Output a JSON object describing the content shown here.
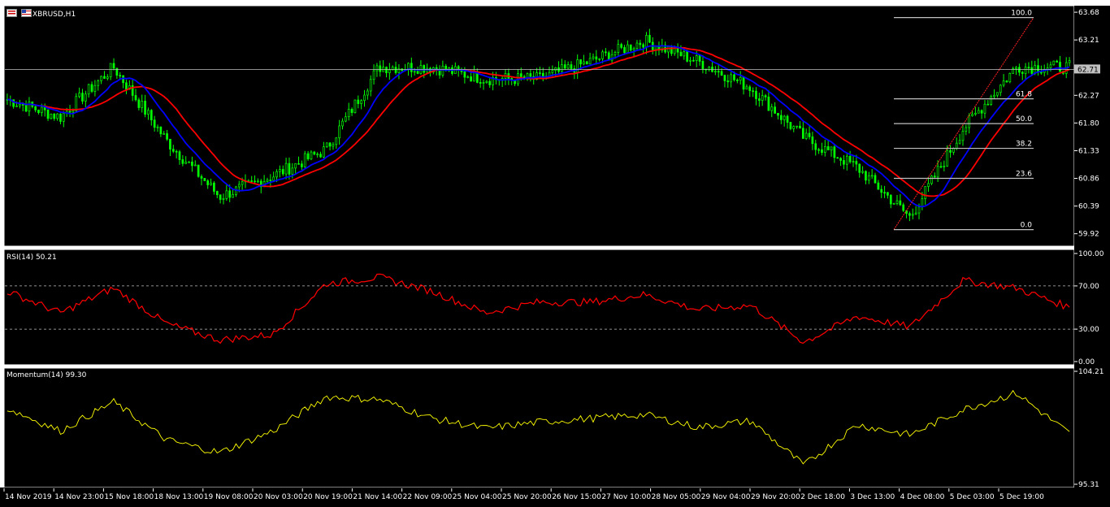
{
  "window": {
    "symbol_label": "XBRUSD,H1",
    "current_price": "62.71"
  },
  "colors": {
    "background": "#000000",
    "frame": "#ffffff",
    "candle": "#00ff00",
    "ma_fast": "#0000ff",
    "ma_slow": "#ff0000",
    "fib": "#c0c0c0",
    "rsi": "#ff0000",
    "momentum": "#ffff00"
  },
  "main_panel": {
    "price_ticks": [
      "63.68",
      "63.21",
      "62.74",
      "62.27",
      "61.80",
      "61.33",
      "60.86",
      "60.39",
      "59.92"
    ],
    "fibonacci": {
      "levels": [
        {
          "label": "100.0",
          "price": 63.59
        },
        {
          "label": "61.8",
          "price": 62.21
        },
        {
          "label": "50.0",
          "price": 61.79
        },
        {
          "label": "38.2",
          "price": 61.37
        },
        {
          "label": "23.6",
          "price": 60.86
        },
        {
          "label": "0.0",
          "price": 59.99
        }
      ]
    }
  },
  "rsi_panel": {
    "title": "RSI(14) 50.21",
    "ticks": [
      "100.00",
      "70.00",
      "30.00",
      "0.00"
    ],
    "levels": [
      70,
      30
    ]
  },
  "momentum_panel": {
    "title": "Momentum(14) 99.30",
    "ticks": [
      "104.21",
      "95.31"
    ]
  },
  "time_axis": {
    "labels": [
      "14 Nov 2019",
      "14 Nov 23:00",
      "15 Nov 18:00",
      "18 Nov 13:00",
      "19 Nov 08:00",
      "20 Nov 03:00",
      "20 Nov 19:00",
      "21 Nov 14:00",
      "22 Nov 09:00",
      "25 Nov 04:00",
      "25 Nov 20:00",
      "26 Nov 15:00",
      "27 Nov 10:00",
      "28 Nov 05:00",
      "29 Nov 04:00",
      "29 Nov 20:00",
      "2 Dec 18:00",
      "3 Dec 13:00",
      "4 Dec 08:00",
      "5 Dec 03:00",
      "5 Dec 19:00"
    ]
  },
  "chart_data": {
    "type": "line",
    "symbol": "XBRUSD",
    "timeframe": "H1",
    "ylim": [
      59.75,
      63.75
    ],
    "price_series": {
      "name": "XBRUSD,H1",
      "x": [
        "14 Nov 2019",
        "14 Nov 23:00",
        "15 Nov 18:00",
        "18 Nov 13:00",
        "19 Nov 08:00",
        "20 Nov 03:00",
        "20 Nov 19:00",
        "21 Nov 14:00",
        "22 Nov 09:00",
        "25 Nov 04:00",
        "25 Nov 20:00",
        "26 Nov 15:00",
        "27 Nov 10:00",
        "28 Nov 05:00",
        "29 Nov 04:00",
        "29 Nov 20:00",
        "2 Dec 18:00",
        "3 Dec 13:00",
        "4 Dec 08:00",
        "5 Dec 03:00",
        "5 Dec 19:00"
      ],
      "close": [
        62.2,
        61.9,
        62.75,
        61.5,
        60.55,
        60.9,
        61.35,
        62.75,
        62.75,
        62.55,
        62.55,
        62.85,
        63.2,
        62.85,
        62.4,
        61.55,
        61.05,
        60.2,
        61.7,
        62.75,
        62.75
      ]
    },
    "rsi": {
      "name": "RSI(14)",
      "ylim": [
        0,
        100
      ],
      "values": [
        65,
        45,
        68,
        35,
        20,
        25,
        72,
        78,
        65,
        45,
        55,
        55,
        62,
        48,
        52,
        18,
        42,
        32,
        75,
        68,
        50
      ]
    },
    "momentum": {
      "name": "Momentum(14)",
      "ylim": [
        95.31,
        104.21
      ],
      "values": [
        101.3,
        99.5,
        101.8,
        98.8,
        97.8,
        99.5,
        102.2,
        102.0,
        100.5,
        99.7,
        100.2,
        100.5,
        100.8,
        99.8,
        100.3,
        96.8,
        100.0,
        99.2,
        101.2,
        102.5,
        99.3
      ]
    }
  }
}
